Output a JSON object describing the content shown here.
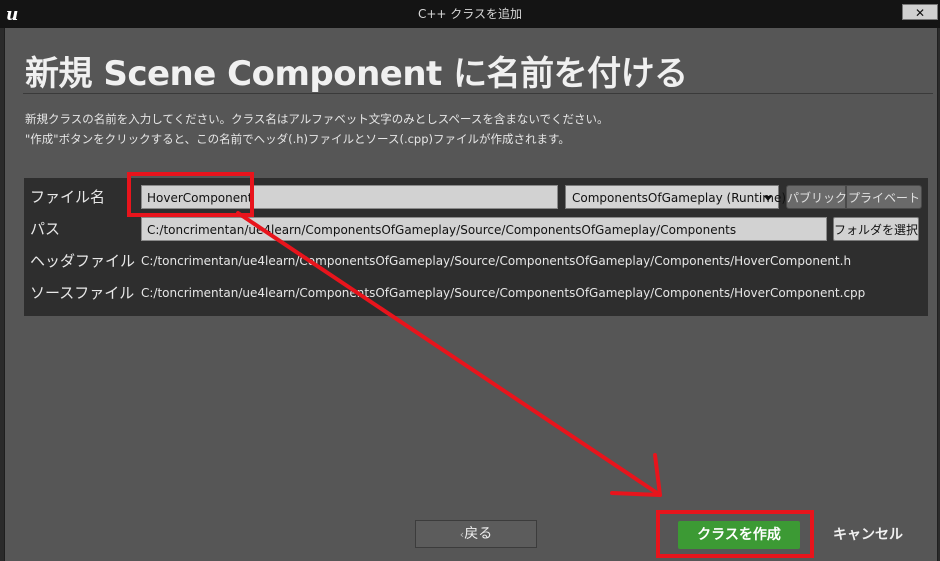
{
  "window": {
    "title": "C++ クラスを追加",
    "close_symbol": "✕",
    "logo_icon": "unreal-engine-logo-icon"
  },
  "heading": "新規 Scene Component に名前を付ける",
  "description": [
    "新規クラスの名前を入力してください。クラス名はアルファベット文字のみとしスペースを含まないでください。",
    "\"作成\"ボタンをクリックすると、この名前でヘッダ(.h)ファイルとソース(.cpp)ファイルが作成されます。"
  ],
  "form": {
    "filename_label": "ファイル名",
    "filename_value": "HoverComponent",
    "module_value": "ComponentsOfGameplay (Runtime)",
    "public_label": "パブリック",
    "private_label": "プライベート",
    "path_label": "パス",
    "path_value": "C:/toncrimentan/ue4learn/ComponentsOfGameplay/Source/ComponentsOfGameplay/Components",
    "choose_folder_label": "フォルダを選択",
    "header_label": "ヘッダファイル",
    "header_value": "C:/toncrimentan/ue4learn/ComponentsOfGameplay/Source/ComponentsOfGameplay/Components/HoverComponent.h",
    "source_label": "ソースファイル",
    "source_value": "C:/toncrimentan/ue4learn/ComponentsOfGameplay/Source/ComponentsOfGameplay/Components/HoverComponent.cpp"
  },
  "buttons": {
    "back_label": "戻る",
    "back_icon": "chevron-left-icon",
    "create_label": "クラスを作成",
    "cancel_label": "キャンセル"
  },
  "colors": {
    "annotation_red": "#e8141c",
    "create_green": "#3c9a34",
    "dialog_bg": "#565656"
  }
}
